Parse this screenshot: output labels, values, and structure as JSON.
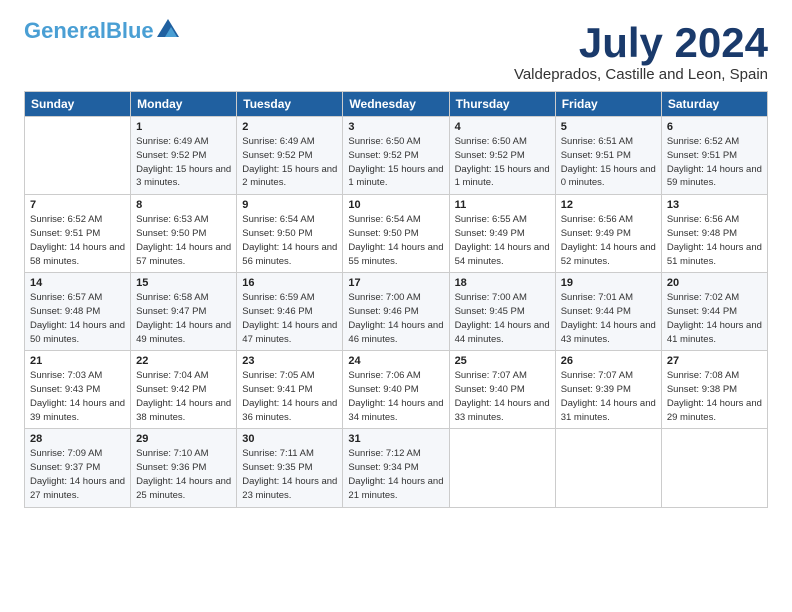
{
  "logo": {
    "general": "General",
    "blue": "Blue"
  },
  "title": {
    "month_year": "July 2024",
    "location": "Valdeprados, Castille and Leon, Spain"
  },
  "days_of_week": [
    "Sunday",
    "Monday",
    "Tuesday",
    "Wednesday",
    "Thursday",
    "Friday",
    "Saturday"
  ],
  "weeks": [
    [
      {
        "day": "",
        "sunrise": "",
        "sunset": "",
        "daylight": ""
      },
      {
        "day": "1",
        "sunrise": "Sunrise: 6:49 AM",
        "sunset": "Sunset: 9:52 PM",
        "daylight": "Daylight: 15 hours and 3 minutes."
      },
      {
        "day": "2",
        "sunrise": "Sunrise: 6:49 AM",
        "sunset": "Sunset: 9:52 PM",
        "daylight": "Daylight: 15 hours and 2 minutes."
      },
      {
        "day": "3",
        "sunrise": "Sunrise: 6:50 AM",
        "sunset": "Sunset: 9:52 PM",
        "daylight": "Daylight: 15 hours and 1 minute."
      },
      {
        "day": "4",
        "sunrise": "Sunrise: 6:50 AM",
        "sunset": "Sunset: 9:52 PM",
        "daylight": "Daylight: 15 hours and 1 minute."
      },
      {
        "day": "5",
        "sunrise": "Sunrise: 6:51 AM",
        "sunset": "Sunset: 9:51 PM",
        "daylight": "Daylight: 15 hours and 0 minutes."
      },
      {
        "day": "6",
        "sunrise": "Sunrise: 6:52 AM",
        "sunset": "Sunset: 9:51 PM",
        "daylight": "Daylight: 14 hours and 59 minutes."
      }
    ],
    [
      {
        "day": "7",
        "sunrise": "Sunrise: 6:52 AM",
        "sunset": "Sunset: 9:51 PM",
        "daylight": "Daylight: 14 hours and 58 minutes."
      },
      {
        "day": "8",
        "sunrise": "Sunrise: 6:53 AM",
        "sunset": "Sunset: 9:50 PM",
        "daylight": "Daylight: 14 hours and 57 minutes."
      },
      {
        "day": "9",
        "sunrise": "Sunrise: 6:54 AM",
        "sunset": "Sunset: 9:50 PM",
        "daylight": "Daylight: 14 hours and 56 minutes."
      },
      {
        "day": "10",
        "sunrise": "Sunrise: 6:54 AM",
        "sunset": "Sunset: 9:50 PM",
        "daylight": "Daylight: 14 hours and 55 minutes."
      },
      {
        "day": "11",
        "sunrise": "Sunrise: 6:55 AM",
        "sunset": "Sunset: 9:49 PM",
        "daylight": "Daylight: 14 hours and 54 minutes."
      },
      {
        "day": "12",
        "sunrise": "Sunrise: 6:56 AM",
        "sunset": "Sunset: 9:49 PM",
        "daylight": "Daylight: 14 hours and 52 minutes."
      },
      {
        "day": "13",
        "sunrise": "Sunrise: 6:56 AM",
        "sunset": "Sunset: 9:48 PM",
        "daylight": "Daylight: 14 hours and 51 minutes."
      }
    ],
    [
      {
        "day": "14",
        "sunrise": "Sunrise: 6:57 AM",
        "sunset": "Sunset: 9:48 PM",
        "daylight": "Daylight: 14 hours and 50 minutes."
      },
      {
        "day": "15",
        "sunrise": "Sunrise: 6:58 AM",
        "sunset": "Sunset: 9:47 PM",
        "daylight": "Daylight: 14 hours and 49 minutes."
      },
      {
        "day": "16",
        "sunrise": "Sunrise: 6:59 AM",
        "sunset": "Sunset: 9:46 PM",
        "daylight": "Daylight: 14 hours and 47 minutes."
      },
      {
        "day": "17",
        "sunrise": "Sunrise: 7:00 AM",
        "sunset": "Sunset: 9:46 PM",
        "daylight": "Daylight: 14 hours and 46 minutes."
      },
      {
        "day": "18",
        "sunrise": "Sunrise: 7:00 AM",
        "sunset": "Sunset: 9:45 PM",
        "daylight": "Daylight: 14 hours and 44 minutes."
      },
      {
        "day": "19",
        "sunrise": "Sunrise: 7:01 AM",
        "sunset": "Sunset: 9:44 PM",
        "daylight": "Daylight: 14 hours and 43 minutes."
      },
      {
        "day": "20",
        "sunrise": "Sunrise: 7:02 AM",
        "sunset": "Sunset: 9:44 PM",
        "daylight": "Daylight: 14 hours and 41 minutes."
      }
    ],
    [
      {
        "day": "21",
        "sunrise": "Sunrise: 7:03 AM",
        "sunset": "Sunset: 9:43 PM",
        "daylight": "Daylight: 14 hours and 39 minutes."
      },
      {
        "day": "22",
        "sunrise": "Sunrise: 7:04 AM",
        "sunset": "Sunset: 9:42 PM",
        "daylight": "Daylight: 14 hours and 38 minutes."
      },
      {
        "day": "23",
        "sunrise": "Sunrise: 7:05 AM",
        "sunset": "Sunset: 9:41 PM",
        "daylight": "Daylight: 14 hours and 36 minutes."
      },
      {
        "day": "24",
        "sunrise": "Sunrise: 7:06 AM",
        "sunset": "Sunset: 9:40 PM",
        "daylight": "Daylight: 14 hours and 34 minutes."
      },
      {
        "day": "25",
        "sunrise": "Sunrise: 7:07 AM",
        "sunset": "Sunset: 9:40 PM",
        "daylight": "Daylight: 14 hours and 33 minutes."
      },
      {
        "day": "26",
        "sunrise": "Sunrise: 7:07 AM",
        "sunset": "Sunset: 9:39 PM",
        "daylight": "Daylight: 14 hours and 31 minutes."
      },
      {
        "day": "27",
        "sunrise": "Sunrise: 7:08 AM",
        "sunset": "Sunset: 9:38 PM",
        "daylight": "Daylight: 14 hours and 29 minutes."
      }
    ],
    [
      {
        "day": "28",
        "sunrise": "Sunrise: 7:09 AM",
        "sunset": "Sunset: 9:37 PM",
        "daylight": "Daylight: 14 hours and 27 minutes."
      },
      {
        "day": "29",
        "sunrise": "Sunrise: 7:10 AM",
        "sunset": "Sunset: 9:36 PM",
        "daylight": "Daylight: 14 hours and 25 minutes."
      },
      {
        "day": "30",
        "sunrise": "Sunrise: 7:11 AM",
        "sunset": "Sunset: 9:35 PM",
        "daylight": "Daylight: 14 hours and 23 minutes."
      },
      {
        "day": "31",
        "sunrise": "Sunrise: 7:12 AM",
        "sunset": "Sunset: 9:34 PM",
        "daylight": "Daylight: 14 hours and 21 minutes."
      },
      {
        "day": "",
        "sunrise": "",
        "sunset": "",
        "daylight": ""
      },
      {
        "day": "",
        "sunrise": "",
        "sunset": "",
        "daylight": ""
      },
      {
        "day": "",
        "sunrise": "",
        "sunset": "",
        "daylight": ""
      }
    ]
  ]
}
